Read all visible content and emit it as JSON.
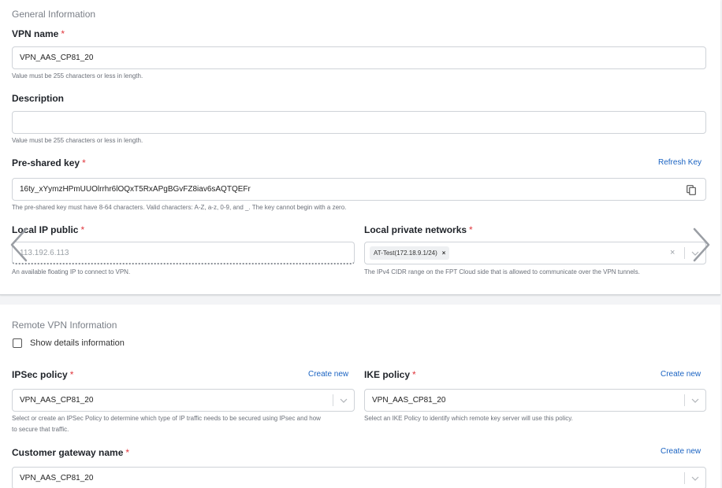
{
  "general": {
    "title": "General Information",
    "vpn_name": {
      "label": "VPN name",
      "required": "*",
      "value": "VPN_AAS_CP81_20",
      "hint": "Value must be 255 characters or less in length."
    },
    "description": {
      "label": "Description",
      "value": "",
      "hint": "Value must be 255 characters or less in length."
    },
    "psk": {
      "label": "Pre-shared key",
      "required": "*",
      "refresh_label": "Refresh Key",
      "value": "16ty_xYymzHPmUUOlrrhr6lOQxT5RxAPgBGvFZ8iav6sAQTQEFr",
      "hint": "The pre-shared key must have 8-64 characters. Valid characters: A-Z, a-z, 0-9, and _. The key cannot begin with a zero."
    },
    "local_ip": {
      "label": "Local IP public",
      "required": "*",
      "placeholder": "113.192.6.113",
      "hint": "An available floating IP to connect to VPN."
    },
    "local_networks": {
      "label": "Local private networks",
      "required": "*",
      "tag": "AT-Test(172.18.9.1/24)",
      "tag_remove": "×",
      "clear": "×",
      "hint": "The IPv4 CIDR range on the FPT Cloud side that is allowed to communicate over the VPN tunnels."
    }
  },
  "remote": {
    "title": "Remote VPN Information",
    "show_details_label": "Show details information",
    "show_details_checked": false,
    "ipsec": {
      "label": "IPSec policy",
      "required": "*",
      "create_label": "Create new",
      "value": "VPN_AAS_CP81_20",
      "hint_line1": "Select or create an IPSec Policy to determine which type of IP traffic needs to be secured using IPsec and how",
      "hint_line2": "to secure that traffic."
    },
    "ike": {
      "label": "IKE policy",
      "required": "*",
      "create_label": "Create new",
      "value": "VPN_AAS_CP81_20",
      "hint": "Select an IKE Policy to identify which remote key server will use this policy."
    },
    "customer_gateway": {
      "label": "Customer gateway name",
      "required": "*",
      "create_label": "Create new",
      "value": "VPN_AAS_CP81_20"
    }
  },
  "icons": {
    "copy": "copy-icon",
    "chevron": "chevron-down-icon",
    "prev": "chevron-left-icon",
    "next": "chevron-right-icon"
  },
  "colors": {
    "required": "#e0373d",
    "link": "#1a63c2",
    "border": "#cfd3d8"
  }
}
